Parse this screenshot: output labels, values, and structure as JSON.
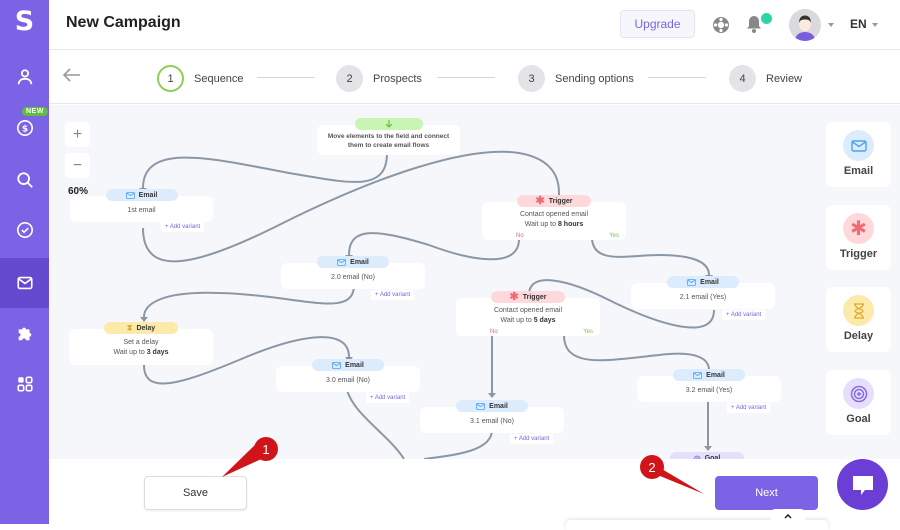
{
  "app": {
    "logo": "S",
    "title": "New Campaign",
    "upgrade_label": "Upgrade",
    "language": "EN"
  },
  "sidebar": {
    "new_badge": "NEW",
    "items": [
      {
        "name": "contacts",
        "icon": "user-icon"
      },
      {
        "name": "billing",
        "icon": "dollar-icon",
        "badge": "NEW"
      },
      {
        "name": "search",
        "icon": "search-icon"
      },
      {
        "name": "tasks",
        "icon": "check-circle-icon"
      },
      {
        "name": "campaigns",
        "icon": "mail-icon",
        "active": true
      },
      {
        "name": "integrations",
        "icon": "puzzle-icon"
      },
      {
        "name": "apps",
        "icon": "grid-icon"
      }
    ]
  },
  "steps": [
    {
      "num": "1",
      "label": "Sequence",
      "active": true
    },
    {
      "num": "2",
      "label": "Prospects"
    },
    {
      "num": "3",
      "label": "Sending options"
    },
    {
      "num": "4",
      "label": "Review"
    }
  ],
  "canvas": {
    "zoom_in": "+",
    "zoom_out": "−",
    "zoom_level": "60%",
    "start_text_1": "Move elements to the field and connect",
    "start_text_2": "them to create email flows",
    "add_variant": "+ Add variant",
    "nodes": {
      "email1": {
        "tag": "Email",
        "text": "1st email"
      },
      "trigger1": {
        "tag": "Trigger",
        "line1": "Contact opened email",
        "line2_prefix": "Wait up to ",
        "line2_bold": "8 hours",
        "no": "No",
        "yes": "Yes"
      },
      "email20": {
        "tag": "Email",
        "text": "2.0 email (No)"
      },
      "email21": {
        "tag": "Email",
        "text": "2.1 email (Yes)"
      },
      "delay1": {
        "tag": "Delay",
        "line1": "Set a delay",
        "line2_prefix": "Wait up to ",
        "line2_bold": "3 days"
      },
      "trigger2": {
        "tag": "Trigger",
        "line1": "Contact opened email",
        "line2_prefix": "Wait up to ",
        "line2_bold": "5 days",
        "no": "No",
        "yes": "Yes"
      },
      "email30": {
        "tag": "Email",
        "text": "3.0 email (No)"
      },
      "email31": {
        "tag": "Email",
        "text": "3.1 email (No)"
      },
      "email32": {
        "tag": "Email",
        "text": "3.2 email (Yes)"
      },
      "goal1": {
        "tag": "Goal"
      }
    }
  },
  "palette": [
    {
      "label": "Email",
      "color": "#dcecfd",
      "icon": "mail-icon"
    },
    {
      "label": "Trigger",
      "color": "#fdd9dc",
      "icon": "asterisk-icon"
    },
    {
      "label": "Delay",
      "color": "#fbeaaa",
      "icon": "hourglass-icon"
    },
    {
      "label": "Goal",
      "color": "#e6dffb",
      "icon": "target-icon"
    }
  ],
  "footer": {
    "save_label": "Save",
    "next_label": "Next"
  },
  "annotations": {
    "marker1": "1",
    "marker2": "2"
  },
  "colors": {
    "accent": "#7b63e6",
    "sidebar": "#7b63e6",
    "marker": "#d0141a",
    "connector": "#8a98a6"
  }
}
